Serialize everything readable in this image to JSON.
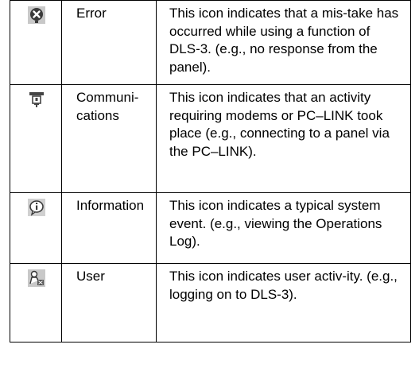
{
  "rows": [
    {
      "icon": "error-icon",
      "name": "Error",
      "description": "This icon indicates that a mis-take has occurred while using a function of DLS-3. (e.g., no response from the panel)."
    },
    {
      "icon": "communications-icon",
      "name": "Communi-cations",
      "description": "This icon indicates that an activity requiring modems or PC–LINK took place (e.g., connecting to a panel via the PC–LINK)."
    },
    {
      "icon": "information-icon",
      "name": "Information",
      "description": "This icon indicates a typical system event. (e.g., viewing the Operations Log)."
    },
    {
      "icon": "user-icon",
      "name": "User",
      "description": "This icon indicates user activ-ity. (e.g., logging on to DLS-3)."
    }
  ]
}
